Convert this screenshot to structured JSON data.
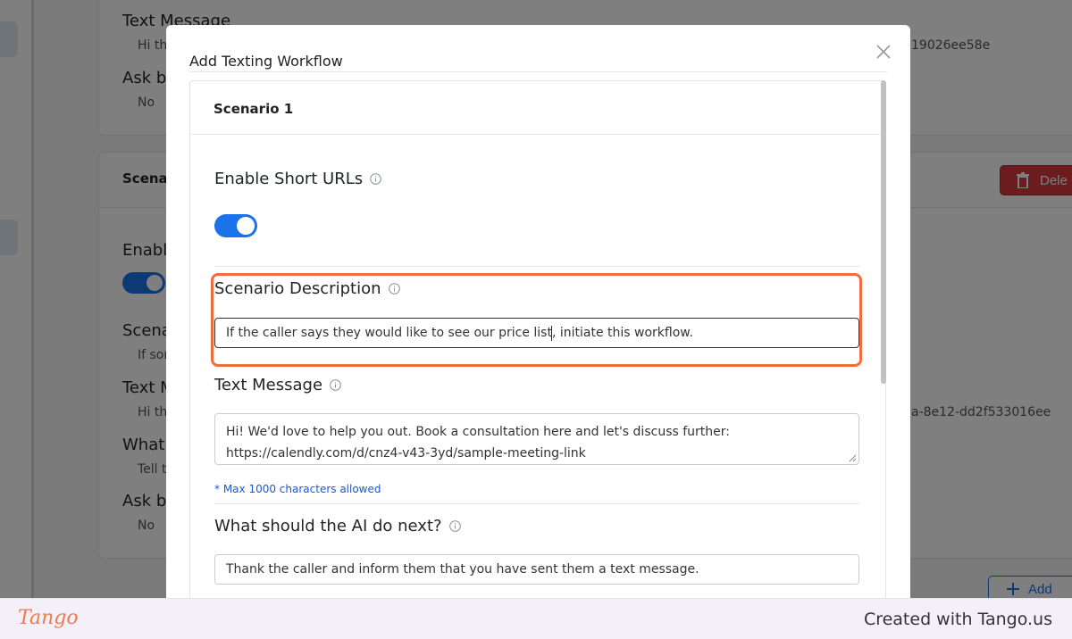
{
  "background": {
    "card1": {
      "text_message_label": "Text Message",
      "text_message_value": "Hi th",
      "link_suffix": "19026ee58e",
      "ask_label": "Ask be",
      "ask_value": "No"
    },
    "card2": {
      "scenario_label": "Scena",
      "enable_label": "Enable",
      "scenario_desc_label": "Scena",
      "scenario_desc_value": "If sor",
      "text_message_label": "Text M",
      "text_message_value": "Hi th",
      "link_suffix": "a-8e12-dd2f533016ee",
      "what_label": "What",
      "what_value": "Tell t",
      "ask_label": "Ask be",
      "ask_value": "No",
      "delete_label": "Dele",
      "add_label": "Add"
    }
  },
  "modal": {
    "title": "Add Texting Workflow",
    "scenario_title": "Scenario 1",
    "short_urls_label": "Enable Short URLs",
    "short_urls_enabled": true,
    "scenario_description_label": "Scenario Description",
    "scenario_description_value_before_caret": "If the caller says they would like to see our price list",
    "scenario_description_value_after_caret": ", initiate this workflow.",
    "text_message_label": "Text Message",
    "text_message_line1": "Hi! We'd love to help you out. Book a consultation here and let's discuss further:",
    "text_message_line2": "https://calendly.com/d/cnz4-v43-3yd/sample-meeting-link",
    "max_chars_hint": "* Max 1000 characters allowed",
    "next_action_label": "What should the AI do next?",
    "next_action_value": "Thank the caller and inform them that you have sent them a text message."
  },
  "footer": {
    "logo": "Tango",
    "created_with": "Created with Tango.us"
  },
  "colors": {
    "accent": "#1a73e8",
    "highlight": "#f06d3e",
    "danger": "#d9363e",
    "hint": "#1a56db"
  }
}
